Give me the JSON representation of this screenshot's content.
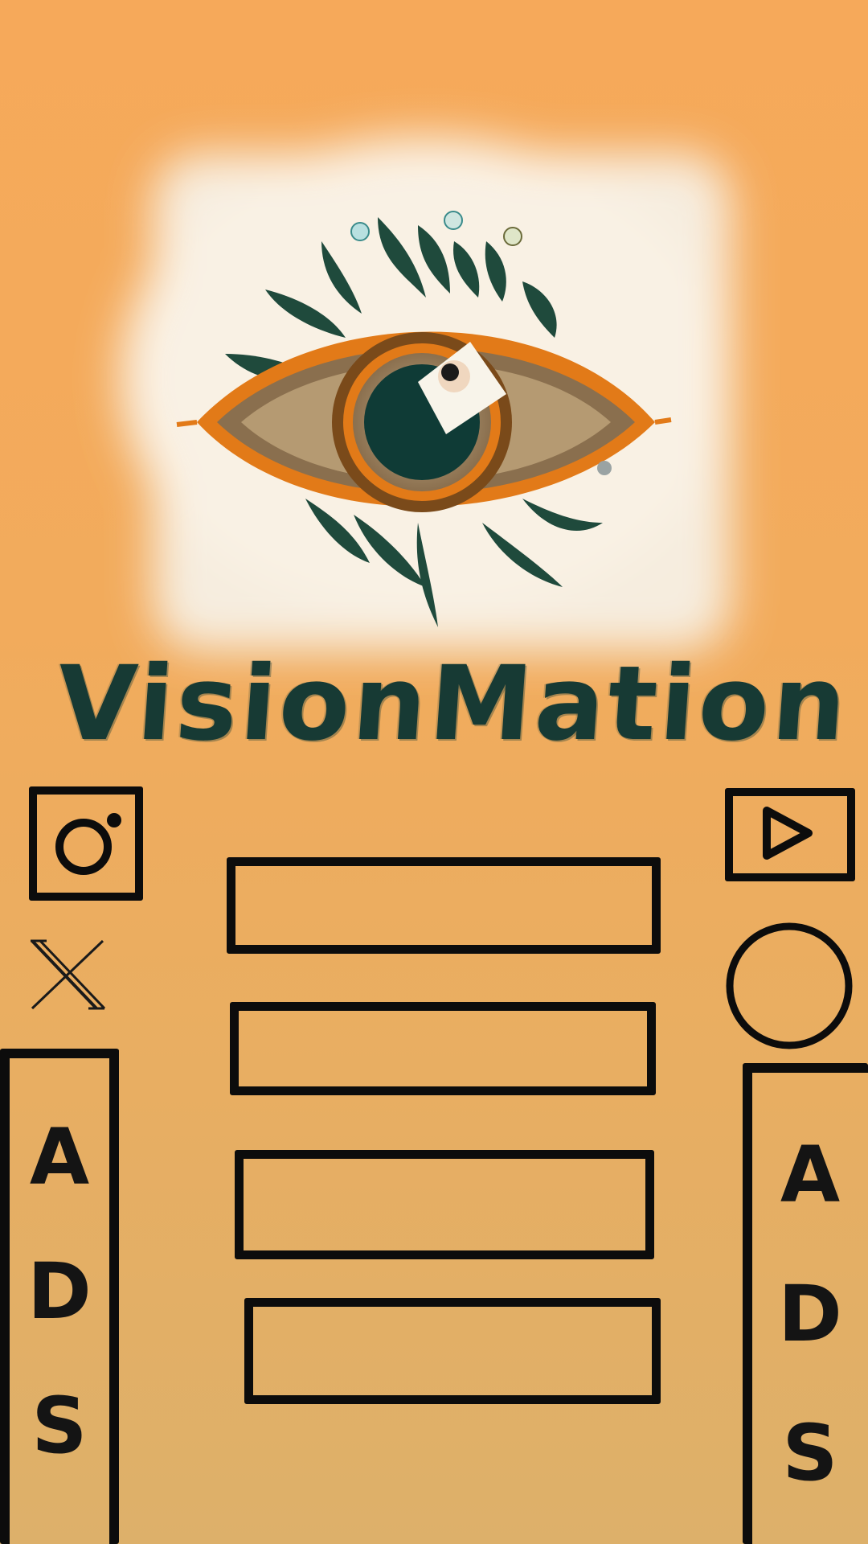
{
  "app": {
    "brand_name": "VisionMation",
    "colors": {
      "background_top": "#f6a95a",
      "background_bottom": "#ddb06a",
      "outline": "#0c0c0c",
      "wordmark": "#173a34",
      "eye_orange": "#e27a18",
      "eye_teal": "#0f3b36",
      "leaf_green": "#1f4a3c",
      "splash_white": "#f7f1e6"
    }
  },
  "logo": {
    "icon": "eye-logo-icon"
  },
  "social_left": {
    "instagram": {
      "icon": "instagram-icon"
    },
    "x": {
      "icon": "x-icon"
    }
  },
  "social_right": {
    "youtube": {
      "icon": "play-icon"
    },
    "circle": {
      "icon": "circle-icon"
    }
  },
  "menu": {
    "buttons": [
      {
        "label": ""
      },
      {
        "label": ""
      },
      {
        "label": ""
      },
      {
        "label": ""
      }
    ]
  },
  "ads": {
    "left": {
      "letters": [
        "A",
        "D",
        "S"
      ]
    },
    "right": {
      "letters": [
        "A",
        "D",
        "S"
      ]
    }
  }
}
